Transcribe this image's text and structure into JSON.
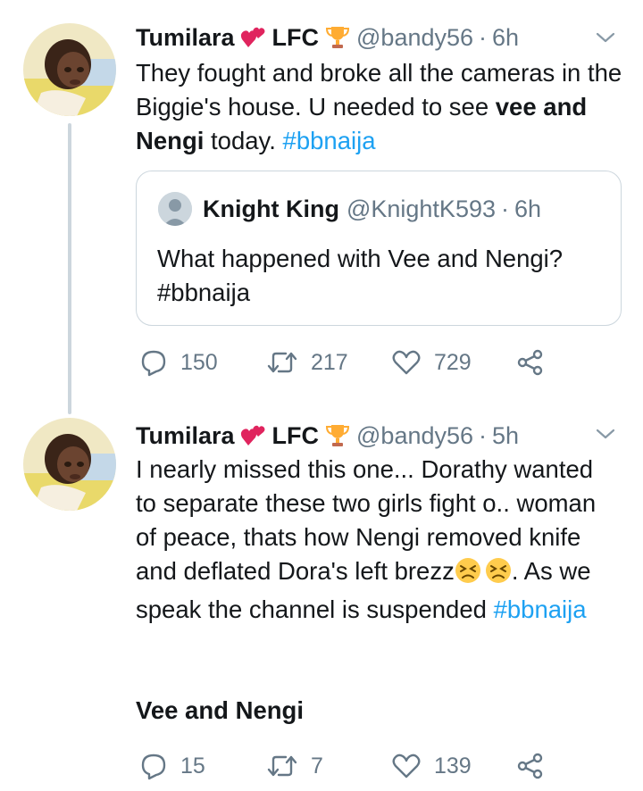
{
  "tweets": [
    {
      "name": "Tumilara",
      "team": "LFC",
      "handle": "@bandy56",
      "dot": "·",
      "time": "6h",
      "text_parts": [
        "They fought and broke all the cameras in the Biggie's house. U needed to see ",
        "vee and Nengi",
        " today. ",
        "#bbnaija"
      ],
      "quote": {
        "name": "Knight King",
        "handle": "@KnightK593",
        "dot": "·",
        "time": "6h",
        "text": "What happened with Vee and Nengi?",
        "hashtag": "#bbnaija"
      },
      "actions": {
        "replies": "150",
        "retweets": "217",
        "likes": "729"
      }
    },
    {
      "name": "Tumilara",
      "team": "LFC",
      "handle": "@bandy56",
      "dot": "·",
      "time": "5h",
      "text_parts": [
        "I nearly missed this one... Dorathy wanted to separate these two girls fight o.. woman of peace, thats how Nengi removed knife and deflated Dora's left brezz",
        ". As we speak the channel is suspended ",
        "#bbnaija"
      ],
      "card_title": "Vee and Nengi",
      "actions": {
        "replies": "15",
        "retweets": "7",
        "likes": "139"
      }
    }
  ],
  "icons": {
    "heart_emoji": "two-hearts-icon",
    "trophy_emoji": "trophy-icon",
    "persevering_emoji": "persevering-face-icon",
    "chevron": "chevron-down-icon",
    "reply": "reply-icon",
    "retweet": "retweet-icon",
    "like": "heart-icon",
    "share": "share-icon"
  },
  "colors": {
    "link": "#1da1f2",
    "muted": "#657786",
    "border": "#ccd6dd",
    "heart_emoji": "#e0245e",
    "trophy_emoji": "#ffac33"
  }
}
